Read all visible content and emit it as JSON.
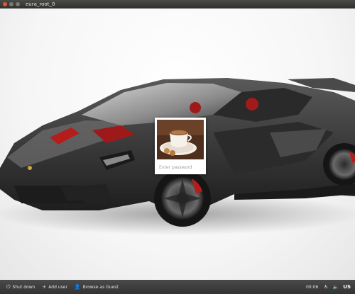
{
  "window": {
    "title": "eura_root_0"
  },
  "login": {
    "password_placeholder": "Enter password"
  },
  "bottom_bar": {
    "shutdown_label": "Shut down",
    "add_user_label": "Add user",
    "guest_label": "Browse as Guest",
    "clock": "00:06",
    "keyboard_layout": "US"
  },
  "icons": {
    "shutdown": "power-icon",
    "add_user": "plus-icon",
    "guest": "person-icon",
    "accessibility": "accessibility-icon",
    "audio": "speaker-icon"
  },
  "colors": {
    "close_button": "#e0553a",
    "panel": "#3b3b3b",
    "car_body": "#3a3a3a",
    "car_accent": "#b51d1d"
  }
}
